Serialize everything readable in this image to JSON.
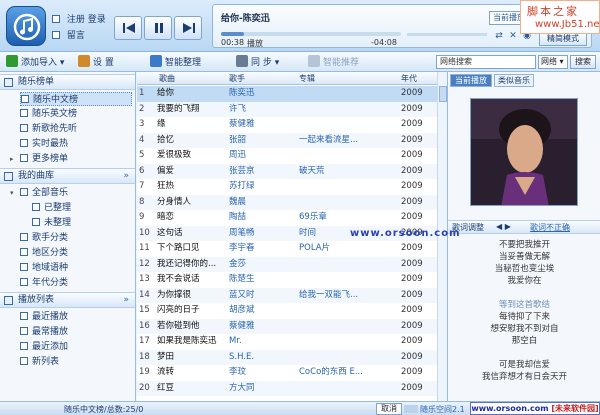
{
  "header": {
    "register": "注册",
    "login": "登录",
    "message": "留言",
    "song_title": "给你-陈奕迅",
    "current_play": "当前播放",
    "elapsed": "00:38",
    "status": "播放",
    "remaining": "-04:08",
    "progress": 0.13,
    "mode": "精简模式"
  },
  "watermark": {
    "top_line1": "脚本之家",
    "top_line2": "www.Jb51.net",
    "middle": "www.orsoon.com",
    "bottom_site": "www.orsoon.com",
    "bottom_tag": "[未来软件园]"
  },
  "toolbar": {
    "add": "添加导入",
    "settings": "设 置",
    "organize": "智能整理",
    "sync": "同 步",
    "recommend": "智能推荐",
    "search_value": "网络搜索",
    "search_scope": "网络",
    "search_button": "搜索"
  },
  "sidebar": {
    "playlist_header": "随乐榜单",
    "playlist_items": [
      "随乐中文榜",
      "随乐英文榜",
      "新歌抢先听",
      "实时最热",
      "更多榜单"
    ],
    "library_header": "我的曲库",
    "library_items": [
      "全部音乐",
      "已整理",
      "未整理",
      "歌手分类",
      "地区分类",
      "地域语种",
      "年代分类"
    ],
    "play_header": "播放列表",
    "play_items": [
      "最近播放",
      "最常播放",
      "最近添加",
      "新列表"
    ]
  },
  "table": {
    "headers": {
      "title": "歌曲",
      "artist": "歌手",
      "album": "专辑",
      "year": "年代"
    },
    "rows": [
      {
        "num": "1",
        "title": "给你",
        "artist": "陈奕迅",
        "album": "",
        "year": "2009"
      },
      {
        "num": "2",
        "title": "我要的飞翔",
        "artist": "许飞",
        "album": "",
        "year": "2009"
      },
      {
        "num": "3",
        "title": "缘",
        "artist": "蔡健雅",
        "album": "",
        "year": "2009"
      },
      {
        "num": "4",
        "title": "拾忆",
        "artist": "张韶",
        "album": "一起来看流星...",
        "year": "2009"
      },
      {
        "num": "5",
        "title": "爱很极致",
        "artist": "周迅",
        "album": "",
        "year": "2009"
      },
      {
        "num": "6",
        "title": "偏爱",
        "artist": "张芸京",
        "album": "破天荒",
        "year": "2009"
      },
      {
        "num": "7",
        "title": "狂热",
        "artist": "苏打绿",
        "album": "",
        "year": "2009"
      },
      {
        "num": "8",
        "title": "分身情人",
        "artist": "魏晨",
        "album": "",
        "year": "2009"
      },
      {
        "num": "9",
        "title": "暗恋",
        "artist": "陶喆",
        "album": "69乐章",
        "year": "2009"
      },
      {
        "num": "10",
        "title": "这句话",
        "artist": "周笔畅",
        "album": "时间",
        "year": "2009"
      },
      {
        "num": "11",
        "title": "下个路口见",
        "artist": "李宇春",
        "album": "POLA片",
        "year": "2009"
      },
      {
        "num": "12",
        "title": "我还记得你的...",
        "artist": "金莎",
        "album": "",
        "year": "2009"
      },
      {
        "num": "13",
        "title": "我不会说话",
        "artist": "陈楚生",
        "album": "",
        "year": "2009"
      },
      {
        "num": "14",
        "title": "为你撑很",
        "artist": "蓝又时",
        "album": "给我一双能飞...",
        "year": "2009"
      },
      {
        "num": "15",
        "title": "闪亮的日子",
        "artist": "胡彦斌",
        "album": "",
        "year": "2009"
      },
      {
        "num": "16",
        "title": "若你碰到他",
        "artist": "蔡健雅",
        "album": "",
        "year": "2009"
      },
      {
        "num": "17",
        "title": "如果我是陈奕迅",
        "artist": "Mr.",
        "album": "",
        "year": "2009"
      },
      {
        "num": "18",
        "title": "梦田",
        "artist": "S.H.E.",
        "album": "",
        "year": "2009"
      },
      {
        "num": "19",
        "title": "流转",
        "artist": "李玟",
        "album": "CoCo的东西 E...",
        "year": "2009"
      },
      {
        "num": "20",
        "title": "红豆",
        "artist": "方大同",
        "album": "",
        "year": "2009"
      }
    ]
  },
  "right": {
    "tab_now": "当前播放",
    "tab_similar": "类似音乐",
    "lyric_label": "歌词调整",
    "lyric_nav": "◀ ▶",
    "lyric_report": "歌词不正确",
    "lyrics": [
      "不要把我推开",
      "当妥善做无解",
      "当秘哲也变尘埃",
      "我爱你在",
      "",
      "等到这首歌结",
      "每待抑了下来",
      "想安慰我不到对自",
      "那空白",
      "",
      "可是我却信爱",
      "我信弃想才有日会天开"
    ],
    "lyric_highlight_index": 5
  },
  "status": {
    "text": "随乐中文榜/总数:25/0",
    "cancel": "取消",
    "space": "随乐空间2.1"
  }
}
